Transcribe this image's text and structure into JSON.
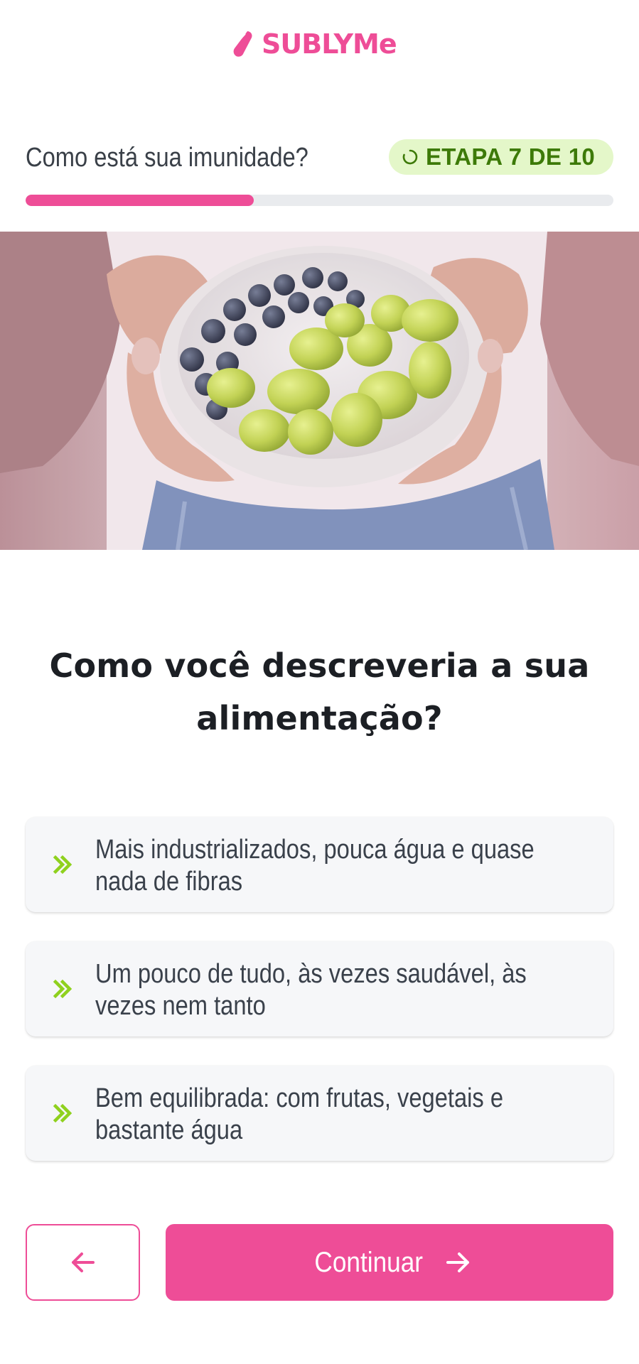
{
  "brand": {
    "name": "SUBLYMe",
    "logo_icon": "brand-leaf-icon",
    "color": "#ee4d97"
  },
  "step": {
    "question": "Como está sua imunidade?",
    "badge_icon": "loading-spinner-icon",
    "badge": "ETAPA 7 DE 10",
    "progress_fraction": 0.3877
  },
  "hero": {
    "image": "hands-holding-bowl-of-blueberries-and-green-grapes"
  },
  "question": {
    "line1": "Como você descreveria a sua",
    "line2": "alimentação?"
  },
  "options": [
    {
      "icon": "double-chevron-right-icon",
      "line1": "Mais industrializados, pouca água e quase",
      "line2": "nada de fibras"
    },
    {
      "icon": "double-chevron-right-icon",
      "line1": "Um pouco de tudo, às vezes saudável, às",
      "line2": "vezes nem tanto"
    },
    {
      "icon": "double-chevron-right-icon",
      "line1": "Bem equilibrada: com frutas, vegetais e",
      "line2": "bastante água"
    }
  ],
  "navigation": {
    "back_icon": "arrow-left-icon",
    "continue_label": "Continuar",
    "continue_icon": "arrow-right-icon"
  },
  "colors": {
    "accent": "#ee4d97",
    "badge_bg": "#e4f7c9",
    "badge_text": "#3d7a08",
    "chevron": "#8fd11e"
  }
}
